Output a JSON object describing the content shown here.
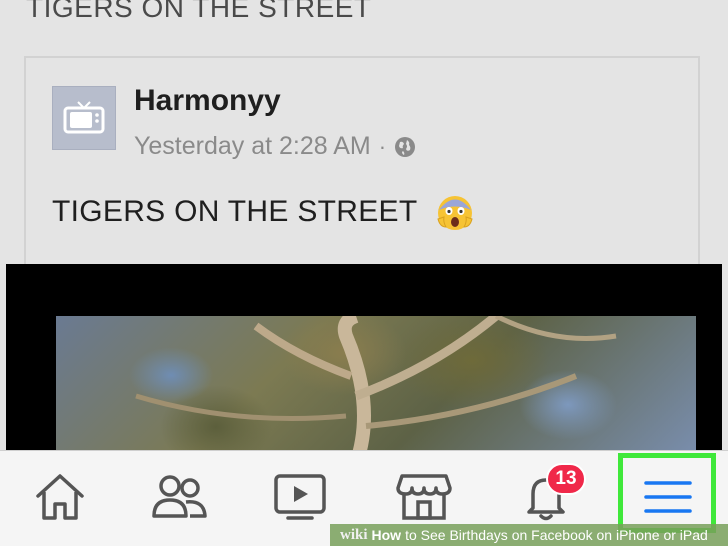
{
  "feed": {
    "header_text": "TIGERS ON THE STREET"
  },
  "post": {
    "author": "Harmonyy",
    "timestamp": "Yesterday at 2:28 AM",
    "separator": "·",
    "privacy_icon": "globe-icon",
    "text": "TIGERS ON THE STREET",
    "emoji": "face-screaming-in-fear",
    "avatar_icon": "tv-icon"
  },
  "tabbar": {
    "items": [
      {
        "name": "home",
        "icon": "home-icon"
      },
      {
        "name": "friends",
        "icon": "friends-icon"
      },
      {
        "name": "watch",
        "icon": "video-icon"
      },
      {
        "name": "marketplace",
        "icon": "store-icon"
      },
      {
        "name": "notifications",
        "icon": "bell-icon",
        "badge": "13"
      },
      {
        "name": "menu",
        "icon": "menu-icon",
        "highlighted": true
      }
    ],
    "active_color": "#1877f2",
    "icon_color": "#555555",
    "badge_color": "#f02849",
    "highlight_color": "#3fe83a"
  },
  "watermark": {
    "brand": "wiki",
    "how": "How",
    "text": "to See Birthdays on Facebook on iPhone or iPad"
  }
}
